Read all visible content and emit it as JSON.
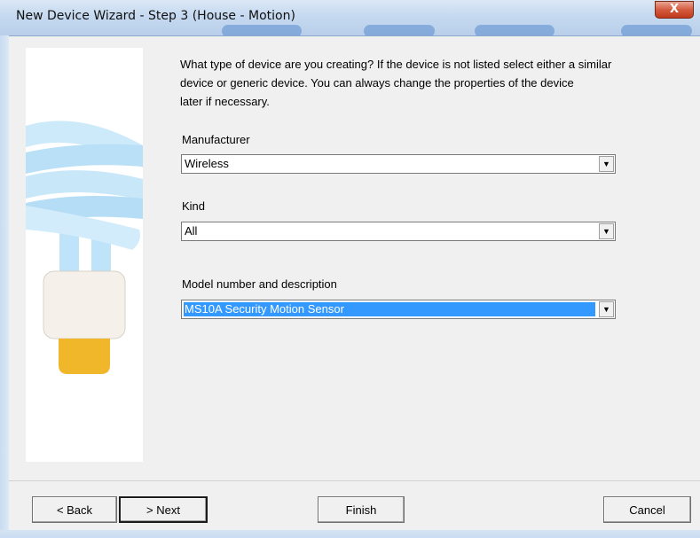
{
  "window": {
    "title": "New Device Wizard - Step 3 (House - Motion)",
    "close_glyph": "X"
  },
  "prompt": {
    "line1": "What type of device are you creating?  If the device is not listed select either a similar",
    "line2": "device or generic device.  You can always change the properties of the device",
    "line3": "later if necessary."
  },
  "manufacturer": {
    "label": "Manufacturer",
    "value": "Wireless"
  },
  "kind": {
    "label": "Kind",
    "value": "All"
  },
  "model": {
    "label": "Model number and description",
    "value": "MS10A Security Motion Sensor"
  },
  "dropdown_arrow": "▼",
  "buttons": {
    "back": "< Back",
    "next": "> Next",
    "finish": "Finish",
    "cancel": "Cancel"
  },
  "illustration": {
    "icon": "cfl-light-bulb-icon"
  },
  "colors": {
    "selection": "#3399ff",
    "close_button": "#c0391c",
    "bulb_spiral": "#bfe3f8",
    "bulb_base": "#f5f0ea",
    "bulb_socket": "#f0b72a"
  }
}
